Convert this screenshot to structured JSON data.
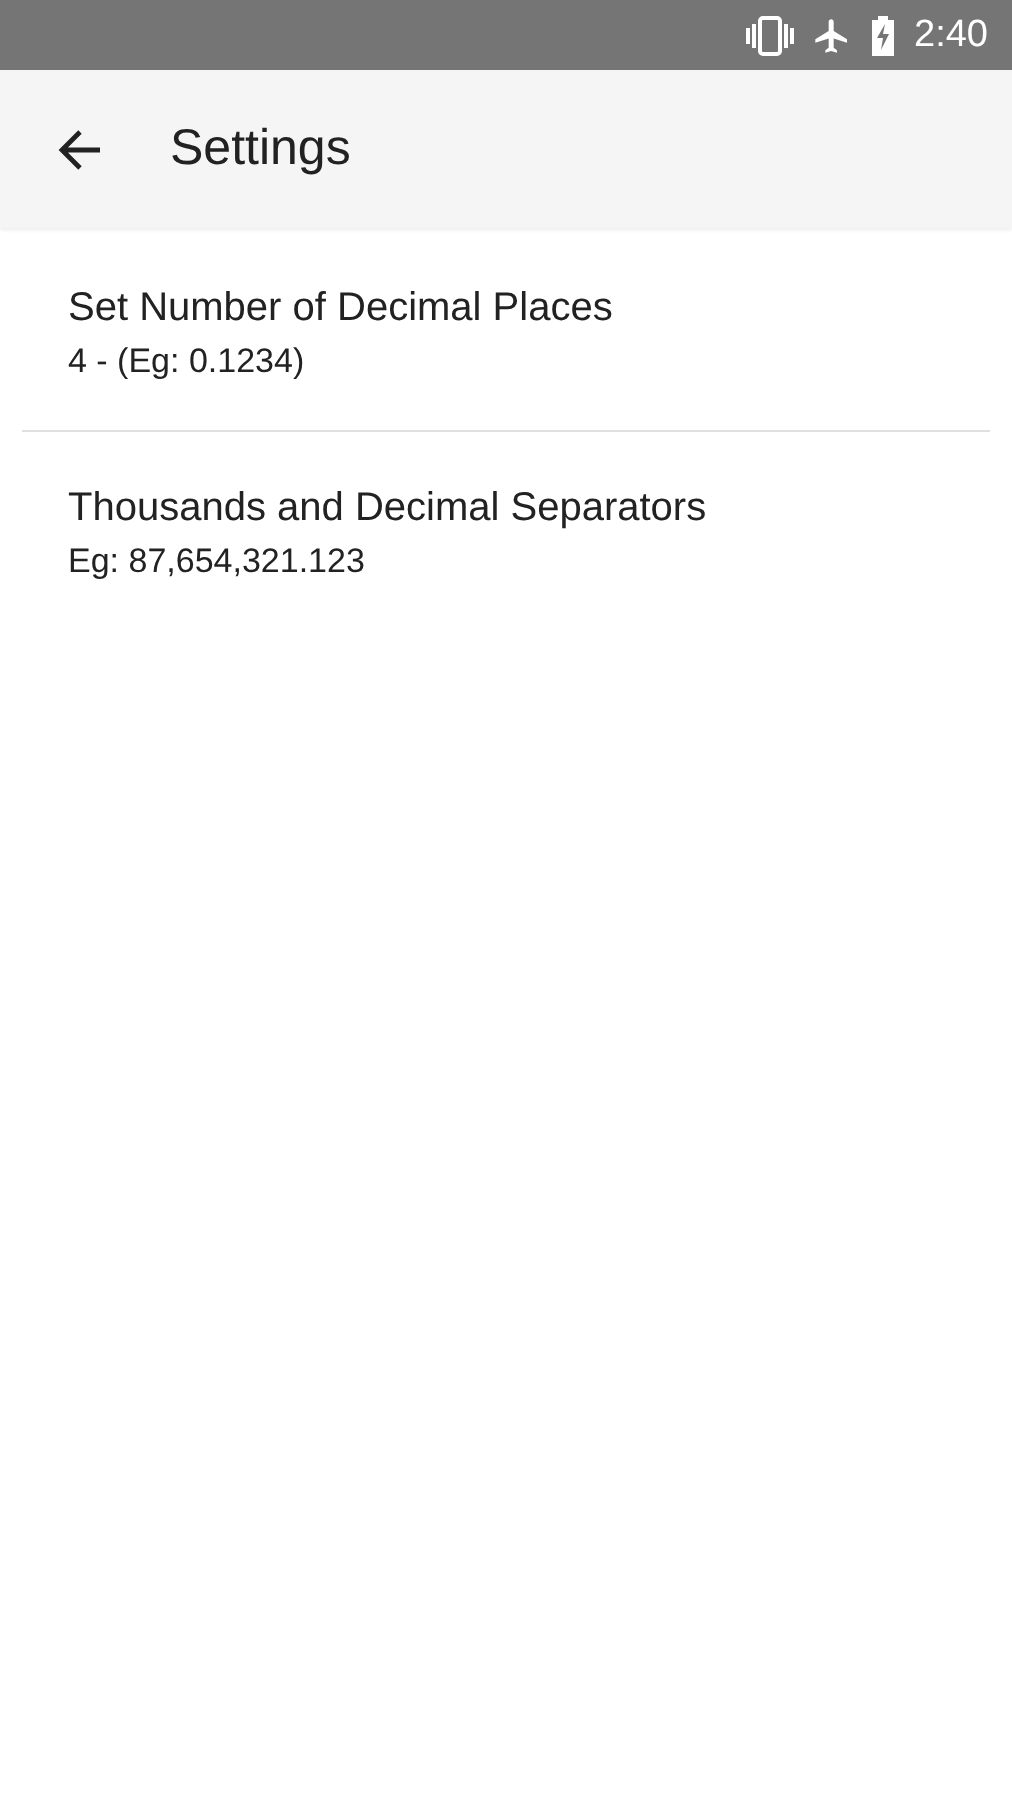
{
  "status_bar": {
    "time": "2:40"
  },
  "toolbar": {
    "title": "Settings"
  },
  "settings": [
    {
      "title": "Set Number of Decimal Places",
      "summary": "4 - (Eg: 0.1234)"
    },
    {
      "title": "Thousands and Decimal Separators",
      "summary": "Eg: 87,654,321.123"
    }
  ]
}
